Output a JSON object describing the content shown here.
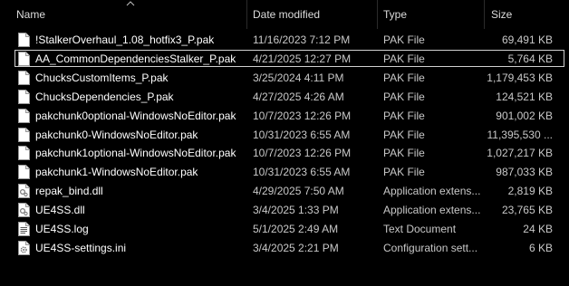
{
  "columns": {
    "name": "Name",
    "date": "Date modified",
    "type": "Type",
    "size": "Size"
  },
  "sort": {
    "column": "name",
    "icon": "chevron-up-icon"
  },
  "files": [
    {
      "name": "!StalkerOverhaul_1.08_hotfix3_P.pak",
      "date": "11/16/2023 7:12 PM",
      "type": "PAK File",
      "size": "69,491 KB",
      "icon": "file-icon"
    },
    {
      "name": "AA_CommonDependenciesStalker_P.pak",
      "date": "4/21/2025 12:27 PM",
      "type": "PAK File",
      "size": "5,764 KB",
      "icon": "file-icon",
      "focused": true
    },
    {
      "name": "ChucksCustomItems_P.pak",
      "date": "3/25/2024 4:11 PM",
      "type": "PAK File",
      "size": "1,179,453 KB",
      "icon": "file-icon"
    },
    {
      "name": "ChucksDependencies_P.pak",
      "date": "4/27/2025 4:26 AM",
      "type": "PAK File",
      "size": "124,521 KB",
      "icon": "file-icon"
    },
    {
      "name": "pakchunk0optional-WindowsNoEditor.pak",
      "date": "10/7/2023 12:26 PM",
      "type": "PAK File",
      "size": "901,002 KB",
      "icon": "file-icon"
    },
    {
      "name": "pakchunk0-WindowsNoEditor.pak",
      "date": "10/31/2023 6:55 AM",
      "type": "PAK File",
      "size": "11,395,530 ...",
      "icon": "file-icon"
    },
    {
      "name": "pakchunk1optional-WindowsNoEditor.pak",
      "date": "10/7/2023 12:26 PM",
      "type": "PAK File",
      "size": "1,027,217 KB",
      "icon": "file-icon"
    },
    {
      "name": "pakchunk1-WindowsNoEditor.pak",
      "date": "10/31/2023 6:55 AM",
      "type": "PAK File",
      "size": "987,033 KB",
      "icon": "file-icon"
    },
    {
      "name": "repak_bind.dll",
      "date": "4/29/2025 7:50 AM",
      "type": "Application extens...",
      "size": "2,819 KB",
      "icon": "dll-icon"
    },
    {
      "name": "UE4SS.dll",
      "date": "3/4/2025 1:33 PM",
      "type": "Application extens...",
      "size": "23,765 KB",
      "icon": "dll-icon"
    },
    {
      "name": "UE4SS.log",
      "date": "5/1/2025 2:49 AM",
      "type": "Text Document",
      "size": "24 KB",
      "icon": "text-document-icon"
    },
    {
      "name": "UE4SS-settings.ini",
      "date": "3/4/2025 2:21 PM",
      "type": "Configuration sett...",
      "size": "6 KB",
      "icon": "settings-file-icon"
    }
  ]
}
